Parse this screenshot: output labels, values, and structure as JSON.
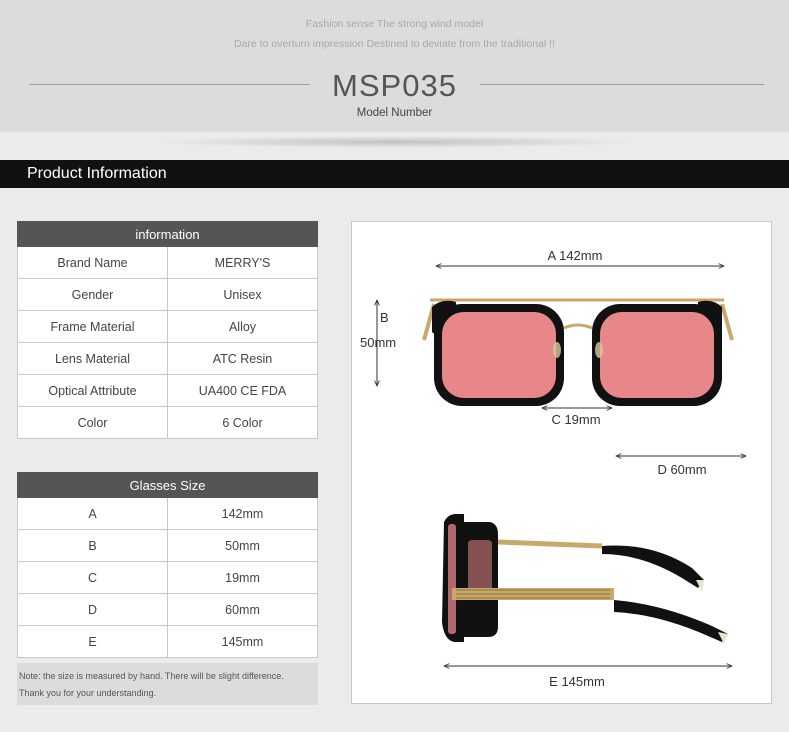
{
  "header": {
    "tagline_1": "Fashion sense The strong wind model",
    "tagline_2": "Dare to overturn impression Destined to deviate from the traditional !!",
    "model_number": "MSP035",
    "model_label": "Model Number"
  },
  "section_title": "Product Information",
  "info_table": {
    "header": "information",
    "rows": [
      {
        "label": "Brand Name",
        "value": "MERRY'S"
      },
      {
        "label": "Gender",
        "value": "Unisex"
      },
      {
        "label": "Frame Material",
        "value": "Alloy"
      },
      {
        "label": "Lens Material",
        "value": "ATC Resin"
      },
      {
        "label": "Optical Attribute",
        "value": "UA400 CE FDA"
      },
      {
        "label": "Color",
        "value": "6 Color"
      }
    ]
  },
  "size_table": {
    "header": "Glasses Size",
    "rows": [
      {
        "label": "A",
        "value": "142mm"
      },
      {
        "label": "B",
        "value": "50mm"
      },
      {
        "label": "C",
        "value": "19mm"
      },
      {
        "label": "D",
        "value": "60mm"
      },
      {
        "label": "E",
        "value": "145mm"
      }
    ]
  },
  "note": {
    "line_1": "Note: the size is measured by hand. There will be slight difference.",
    "line_2": "Thank you for your understanding."
  },
  "diagram": {
    "dim_a": "A 142mm",
    "dim_b_letter": "B",
    "dim_b_value": "50mm",
    "dim_c": "C 19mm",
    "dim_d": "D 60mm",
    "dim_e": "E 145mm"
  },
  "colors": {
    "lens": "#e8878a",
    "frame": "#111111",
    "metal": "#c9a96a",
    "header_bar": "#111111",
    "table_head": "#555555"
  }
}
